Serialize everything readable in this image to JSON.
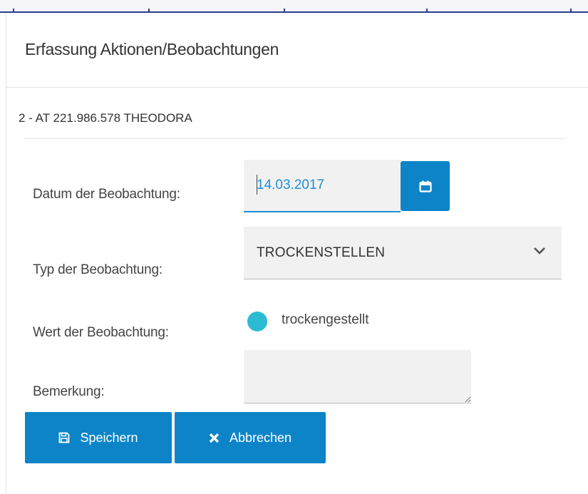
{
  "dialog": {
    "title": "Erfassung Aktionen/Beobachtungen",
    "record": "2 - AT 221.986.578 THEODORA"
  },
  "form": {
    "date_label": "Datum der Beobachtung:",
    "date_value": "14.03.2017",
    "type_label": "Typ der Beobachtung:",
    "type_value": "TROCKENSTELLEN",
    "value_label": "Wert der Beobachtung:",
    "value_option": "trockengestellt",
    "remark_label": "Bemerkung:",
    "remark_value": ""
  },
  "buttons": {
    "save": "Speichern",
    "cancel": "Abbrechen"
  },
  "icons": {
    "calendar": "calendar-icon",
    "chevron": "chevron-down-icon",
    "save": "floppy-disk-icon",
    "cancel": "close-icon"
  },
  "colors": {
    "primary": "#0d84c8",
    "radio": "#2bbcd4",
    "input_bg": "#f1f1f1"
  }
}
